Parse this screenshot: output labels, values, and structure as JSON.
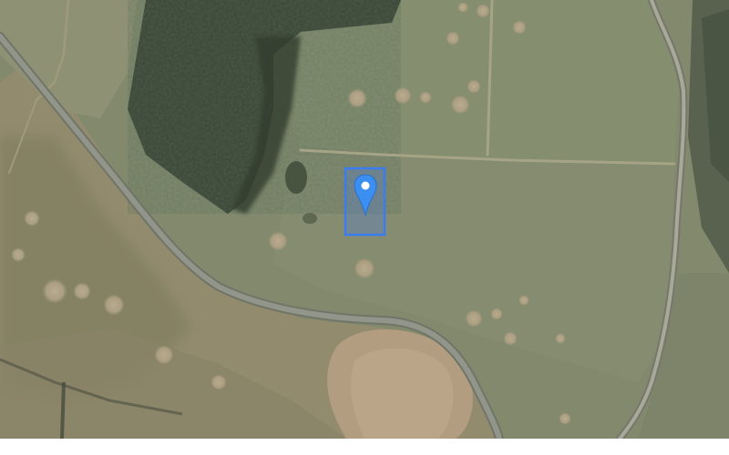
{
  "map": {
    "type": "satellite",
    "marker": {
      "icon": "location-pin-icon",
      "color": "#3b8ff0"
    },
    "selection": {
      "shape": "rectangle",
      "stroke_color": "#3b7cf0",
      "fill_color": "#4a7fe8"
    },
    "features": [
      "forest-patch",
      "curved-road",
      "field-boundary-track",
      "eastern-road",
      "grassland-fields",
      "heath-patches"
    ]
  }
}
